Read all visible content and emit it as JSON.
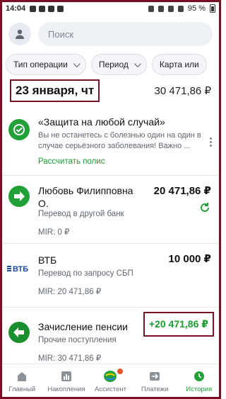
{
  "status_bar": {
    "time": "14:04",
    "battery": "95 %"
  },
  "search": {
    "placeholder": "Поиск"
  },
  "filters": [
    {
      "label": "Тип операции"
    },
    {
      "label": "Период"
    },
    {
      "label": "Карта или"
    }
  ],
  "day": {
    "title": "23 января, чт",
    "total": "30 471,86 ₽"
  },
  "promo": {
    "title": "«Защита на любой случай»",
    "description": "Вы не останетесь с болезнью один на один в случае серьёзного заболевания! Важно ...",
    "cta": "Рассчитать полис"
  },
  "transactions": [
    {
      "name": "Любовь Филипповна О.",
      "description": "Перевод в другой банк",
      "card": "MIR: 0 ₽",
      "amount": "20 471,86 ₽"
    },
    {
      "name": "ВТБ",
      "logo_text": "ВТБ",
      "description": "Перевод по запросу СБП",
      "card": "MIR: 20 471,86 ₽",
      "amount": "10 000 ₽"
    },
    {
      "name": "Зачисление пенсии",
      "description": "Прочие поступления",
      "card": "MIR: 30 471,86 ₽",
      "amount": "+20 471,86 ₽"
    }
  ],
  "bottom_nav": [
    {
      "label": "Главный"
    },
    {
      "label": "Накопления"
    },
    {
      "label": "Ассистент"
    },
    {
      "label": "Платежи"
    },
    {
      "label": "История"
    }
  ],
  "colors": {
    "accent_green": "#21a038",
    "highlight_frame": "#7a1024",
    "vtb_blue": "#1b4f9c"
  }
}
